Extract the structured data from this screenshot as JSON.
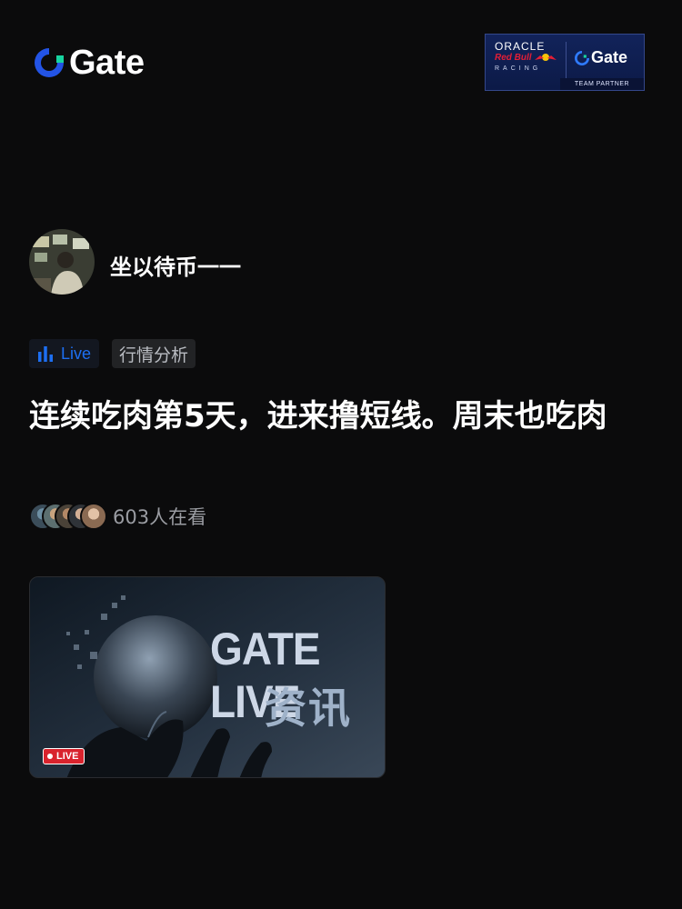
{
  "header": {
    "brand_name": "Gate",
    "brand_color": "#2354e6",
    "partner": {
      "oracle": "ORACLE",
      "redbull": "Red Bull",
      "racing": "RACING",
      "gate": "Gate",
      "team_partner": "TEAM PARTNER",
      "background": "#12235a"
    }
  },
  "user": {
    "name": "坐以待币一一"
  },
  "tags": {
    "live": "Live",
    "category": "行情分析",
    "live_color": "#1d6ff2"
  },
  "post": {
    "title": "连续吃肉第5天，进来撸短线。周末也吃肉",
    "viewers": "603人在看"
  },
  "thumbnail": {
    "headline": "GATE LIVE",
    "subhead": "资讯",
    "badge": "LIVE",
    "badge_color": "#d9232d"
  }
}
